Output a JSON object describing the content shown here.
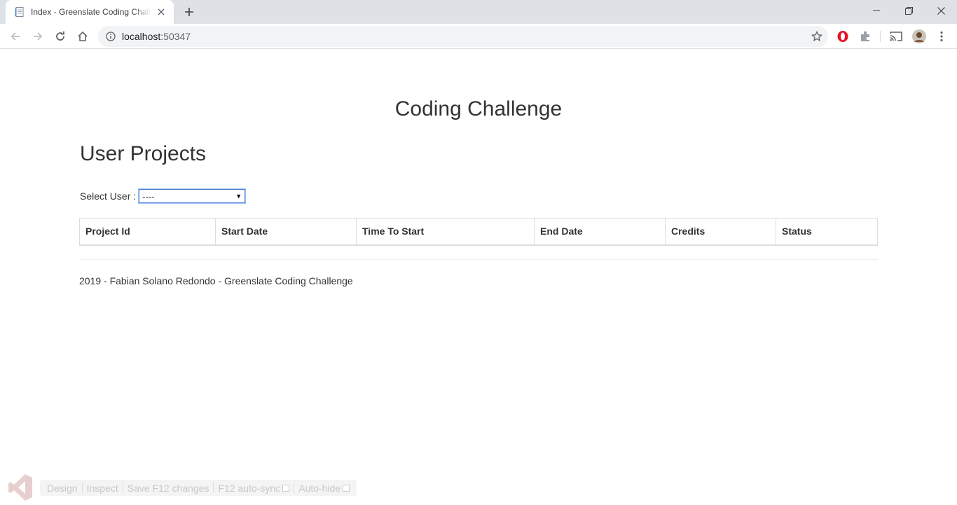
{
  "browser": {
    "tab_title": "Index - Greenslate Coding Challenge",
    "url_host": "localhost",
    "url_port": ":50347"
  },
  "page": {
    "title": "Coding Challenge",
    "section_title": "User Projects",
    "select_label": "Select User :",
    "select_value": "----",
    "table_headers": [
      "Project Id",
      "Start Date",
      "Time To Start",
      "End Date",
      "Credits",
      "Status"
    ],
    "footer": "2019 - Fabian Solano Redondo - Greenslate Coding Challenge"
  },
  "browser_link": {
    "design": "Design",
    "inspect": "Inspect",
    "save": "Save F12 changes",
    "autosync": "F12 auto-sync",
    "autohide": "Auto-hide"
  },
  "icons": {
    "favicon": "document-icon",
    "star": "bookmark-star-icon",
    "ext1": "opera-icon",
    "ext2": "puzzle-extension-icon",
    "cast": "cast-icon",
    "avatar": "profile-avatar-icon"
  },
  "colors": {
    "tabstrip": "#dee1e6",
    "omnibox": "#f1f3f4",
    "text": "#333333"
  }
}
